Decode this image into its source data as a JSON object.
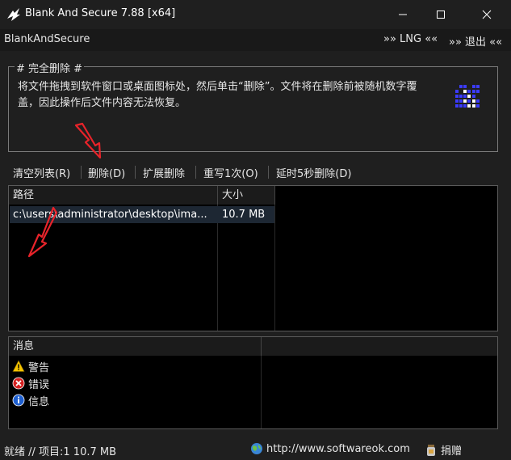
{
  "window": {
    "title": "Blank And Secure 7.88 [x64]",
    "icon": "app-logo-icon",
    "controls": [
      "minimize-icon",
      "maximize-icon",
      "close-icon"
    ]
  },
  "menu": {
    "app_name": "BlankAndSecure",
    "language": "»» LNG ««",
    "exit": "»» 退出 ««"
  },
  "info": {
    "group_title": "# 完全删除 #",
    "text": "将文件拖拽到软件窗口或桌面图标处，然后单击“删除”。文件将在删除前被随机数字覆盖，因此操作后文件内容无法恢复。"
  },
  "toolbar": {
    "clear": "清空列表(R)",
    "delete": "删除(D)",
    "ext_delete": "扩展删除",
    "overwrite": "重写1次(O)",
    "delay": "延时5秒删除(D)"
  },
  "file_list": {
    "headers": [
      "路径",
      "大小"
    ],
    "rows": [
      {
        "path": "c:\\users\\administrator\\desktop\\ima...",
        "size": "10.7 MB",
        "selected": true
      }
    ]
  },
  "messages": {
    "header": "消息",
    "items": [
      {
        "icon": "warning-icon",
        "label": "警告"
      },
      {
        "icon": "error-icon",
        "label": "错误"
      },
      {
        "icon": "info-icon",
        "label": "信息"
      }
    ]
  },
  "status": {
    "text": "就绪 // 项目:1 10.7 MB",
    "url": "http://www.softwareok.com",
    "url_icon": "globe-icon",
    "donate": "捐赠",
    "donate_icon": "donate-jar-icon"
  },
  "colors": {
    "background": "#1f1f1f",
    "list_background": "#000000",
    "selection": "#1d2733",
    "annotation_arrow": "#e8232a"
  }
}
